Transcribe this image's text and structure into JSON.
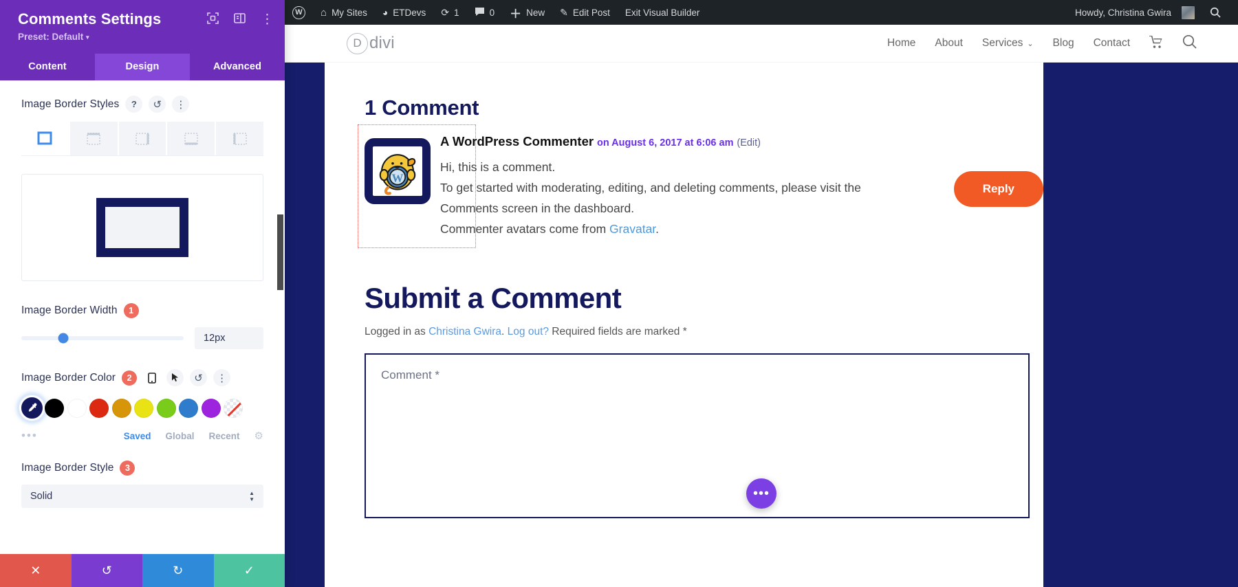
{
  "settings_panel": {
    "title": "Comments Settings",
    "preset": "Preset: Default",
    "preset_caret": "▾",
    "header_icons": [
      {
        "name": "expand-icon",
        "glyph": "⛶"
      },
      {
        "name": "layout-icon",
        "glyph": "▥"
      },
      {
        "name": "more-options-icon",
        "glyph": "⋮"
      }
    ],
    "tabs": [
      {
        "label": "Content",
        "active": false
      },
      {
        "label": "Design",
        "active": true
      },
      {
        "label": "Advanced",
        "active": false
      }
    ],
    "options": {
      "border_styles": {
        "label": "Image Border Styles",
        "help_glyph": "?",
        "reset_glyph": "↺",
        "more_glyph": "⋮",
        "items": [
          "all-sides",
          "top",
          "right",
          "bottom",
          "left"
        ],
        "selected_index": 0
      },
      "preview": {
        "label": "image-border-preview"
      },
      "border_width": {
        "label": "Image Border Width",
        "badge": "1",
        "value": "12px",
        "knob_percent": 26
      },
      "border_color": {
        "label": "Image Border Color",
        "badge": "2",
        "icons": [
          {
            "name": "mobile-icon",
            "glyph": "▯"
          },
          {
            "name": "cursor-icon",
            "glyph": "➤"
          },
          {
            "name": "reset-icon",
            "glyph": "↺"
          },
          {
            "name": "more-options-icon",
            "glyph": "⋮"
          }
        ],
        "selected_color": "#14195E",
        "swatches": [
          {
            "name": "selected-navy",
            "hex": "#14195E",
            "selected": true
          },
          {
            "name": "black",
            "hex": "#000000",
            "selected": false
          },
          {
            "name": "white",
            "hex": "#FFFFFF",
            "selected": false
          },
          {
            "name": "red",
            "hex": "#DC2A12",
            "selected": false
          },
          {
            "name": "orange",
            "hex": "#D79509",
            "selected": false
          },
          {
            "name": "yellow",
            "hex": "#E9E316",
            "selected": false
          },
          {
            "name": "green",
            "hex": "#79CC19",
            "selected": false
          },
          {
            "name": "blue",
            "hex": "#2E7CCB",
            "selected": false
          },
          {
            "name": "purple",
            "hex": "#9E23DE",
            "selected": false
          },
          {
            "name": "none",
            "hex": "none",
            "selected": false
          }
        ],
        "dots": "•••",
        "palette_tabs": [
          {
            "label": "Saved",
            "active": true
          },
          {
            "label": "Global",
            "active": false
          },
          {
            "label": "Recent",
            "active": false
          }
        ],
        "gear_glyph": "⚙"
      },
      "border_style": {
        "label": "Image Border Style",
        "badge": "3",
        "value": "Solid"
      }
    },
    "footer": [
      {
        "name": "cancel-button",
        "glyph": "✕",
        "color": "#E2574C"
      },
      {
        "name": "undo-button",
        "glyph": "↺",
        "color": "#7A3BD0"
      },
      {
        "name": "redo-button",
        "glyph": "↻",
        "color": "#2F8ADA"
      },
      {
        "name": "save-button",
        "glyph": "✓",
        "color": "#4DC3A0"
      }
    ]
  },
  "adminbar": {
    "items": [
      {
        "name": "wordpress-logo-icon",
        "label": "",
        "glyph": "W"
      },
      {
        "name": "my-sites-menu",
        "label": "My Sites",
        "glyph": "⌂"
      },
      {
        "name": "etdevs-site-menu",
        "label": "ETDevs",
        "glyph": "◔"
      },
      {
        "name": "updates-menu",
        "label": "1",
        "glyph": "⟳"
      },
      {
        "name": "comments-menu",
        "label": "0",
        "glyph": "💬"
      },
      {
        "name": "new-content-menu",
        "label": "New",
        "glyph": "＋"
      },
      {
        "name": "edit-post-link",
        "label": "Edit Post",
        "glyph": "✎"
      },
      {
        "name": "exit-visual-builder-link",
        "label": "Exit Visual Builder",
        "glyph": ""
      }
    ],
    "howdy": "Howdy, Christina Gwira",
    "search_glyph": "🔍"
  },
  "site_header": {
    "logo_letter": "D",
    "logo_word": "divi",
    "nav": [
      {
        "label": "Home",
        "has_caret": false
      },
      {
        "label": "About",
        "has_caret": false
      },
      {
        "label": "Services",
        "has_caret": true
      },
      {
        "label": "Blog",
        "has_caret": false
      },
      {
        "label": "Contact",
        "has_caret": false
      }
    ],
    "cart_glyph": "🛒",
    "search_glyph": "🔍"
  },
  "page": {
    "comments_heading": "1 Comment",
    "comment": {
      "author": "A WordPress Commenter",
      "date": "on August 6, 2017 at 6:06 am",
      "edit_label": "(Edit)",
      "lines": [
        "Hi, this is a comment.",
        "To get started with moderating, editing, and deleting comments, please visit the Comments screen in the dashboard.",
        "Commenter avatars come from "
      ],
      "gravatar_link": "Gravatar",
      "gravatar_suffix": ".",
      "reply_label": "Reply"
    },
    "submit_heading": "Submit a Comment",
    "logged_in_prefix": "Logged in as ",
    "logged_in_user": "Christina Gwira",
    "logged_in_sep": ". ",
    "logout_label": "Log out?",
    "required_note": " Required fields are marked *",
    "comment_placeholder": "Comment *",
    "fab_glyph": "•••"
  },
  "colors": {
    "panel_purple": "#6C2EB9",
    "tab_active": "#8447D8",
    "navy": "#14195E",
    "orange": "#F15A24",
    "accent_blue": "#4388E4",
    "badge_red": "#EE6B5E"
  }
}
